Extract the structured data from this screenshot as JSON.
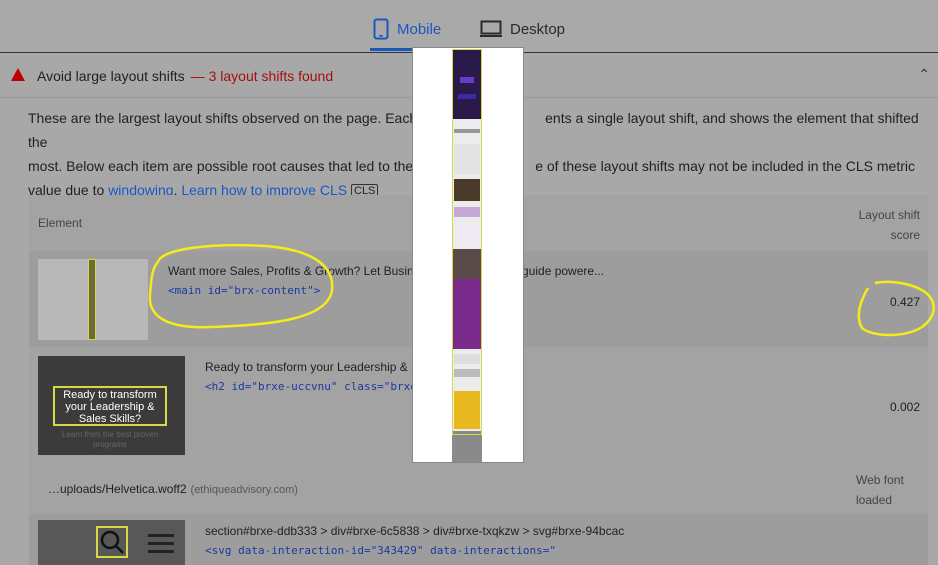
{
  "tabs": {
    "mobile": "Mobile",
    "desktop": "Desktop"
  },
  "audit": {
    "title": "Avoid large layout shifts",
    "separator": "—",
    "count": "3 layout shifts found",
    "desc_part1": "These are the largest layout shifts observed on the page. Each",
    "desc_part2": "ents a single layout shift, and shows the element that shifted the",
    "desc_part3": "most. Below each item are possible root causes that led to the",
    "desc_part4": "e of these layout shifts may not be included in the CLS metric",
    "desc_part5": "value due to",
    "windowing": "windowing",
    "learn_more": "Learn how to improve CLS",
    "cls_badge": "CLS"
  },
  "table": {
    "col_element": "Element",
    "col_score_line1": "Layout shift",
    "col_score_line2": "score",
    "rows": [
      {
        "text": "Want more Sales, Profits & Growth? Let Busine",
        "text_tail": "guide powere...",
        "code": "<main id=\"brx-content\">",
        "score": "0.427"
      },
      {
        "text": "Ready to transform your Leadership & S",
        "code": "<h2 id=\"brxe-uccvnu\" class=\"brxe",
        "score": "0.002",
        "thumb_title": "Ready to transform your Leadership & Sales Skills?",
        "thumb_sub": "Learn from the best proven programs"
      },
      {
        "url": "…uploads/Helvetica.woff2",
        "domain": "(ethiqueadvisory.com)",
        "label_line1": "Web font",
        "label_line2": "loaded"
      },
      {
        "text": "section#brxe-ddb333 > div#brxe-6c5838 > div#brxe-txqkzw > svg#brxe-94bcac",
        "code": "<svg data-interaction-id=\"343429\" data-interactions=\""
      }
    ]
  },
  "colors": {
    "accent": "#1a57c0",
    "warning": "#c00000",
    "highlight": "#d8d846"
  }
}
